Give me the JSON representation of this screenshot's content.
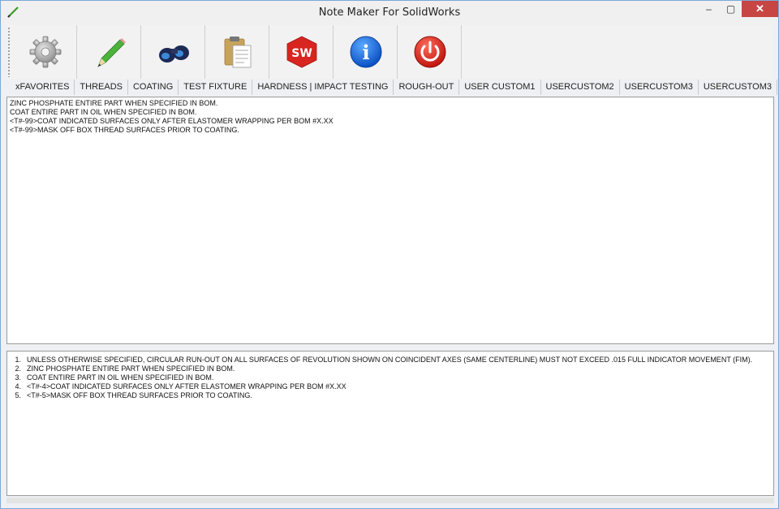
{
  "window": {
    "title": "Note Maker For SolidWorks",
    "controls": {
      "minimize": "–",
      "maximize": "▢",
      "close": "✕"
    }
  },
  "toolbar": {
    "buttons": [
      {
        "icon": "gear-icon"
      },
      {
        "icon": "pencil-icon"
      },
      {
        "icon": "binoculars-icon"
      },
      {
        "icon": "clipboard-icon"
      },
      {
        "icon": "solidworks-icon"
      },
      {
        "icon": "info-icon"
      },
      {
        "icon": "power-icon"
      }
    ],
    "solidworks_text": "SW",
    "info_text": "i"
  },
  "tabs": [
    "xFAVORITES",
    "THREADS",
    "COATING",
    "TEST FIXTURE",
    "HARDNESS | IMPACT TESTING",
    "ROUGH-OUT",
    "USER CUSTOM1",
    "USERCUSTOM2",
    "USERCUSTOM3",
    "USERCUSTOM3"
  ],
  "top_notes": [
    "ZINC PHOSPHATE ENTIRE PART WHEN SPECIFIED IN BOM.",
    "COAT ENTIRE PART IN OIL WHEN SPECIFIED IN BOM.",
    "<T#-99>COAT INDICATED SURFACES ONLY AFTER ELASTOMER WRAPPING PER BOM #X.XX",
    "<T#-99>MASK OFF BOX THREAD SURFACES PRIOR TO COATING."
  ],
  "bottom_notes": [
    {
      "num": "1.",
      "text": "UNLESS OTHERWISE SPECIFIED, CIRCULAR RUN-OUT ON ALL SURFACES OF REVOLUTION SHOWN ON COINCIDENT AXES (SAME CENTERLINE) MUST NOT EXCEED .015 FULL INDICATOR MOVEMENT (FIM)."
    },
    {
      "num": "2.",
      "text": "ZINC PHOSPHATE ENTIRE PART WHEN SPECIFIED IN BOM."
    },
    {
      "num": "3.",
      "text": "COAT ENTIRE PART IN OIL WHEN SPECIFIED IN BOM."
    },
    {
      "num": "4.",
      "text": "<T#-4>COAT INDICATED SURFACES ONLY AFTER ELASTOMER WRAPPING PER BOM #X.XX"
    },
    {
      "num": "5.",
      "text": "<T#-5>MASK OFF BOX THREAD SURFACES PRIOR TO COATING."
    }
  ]
}
